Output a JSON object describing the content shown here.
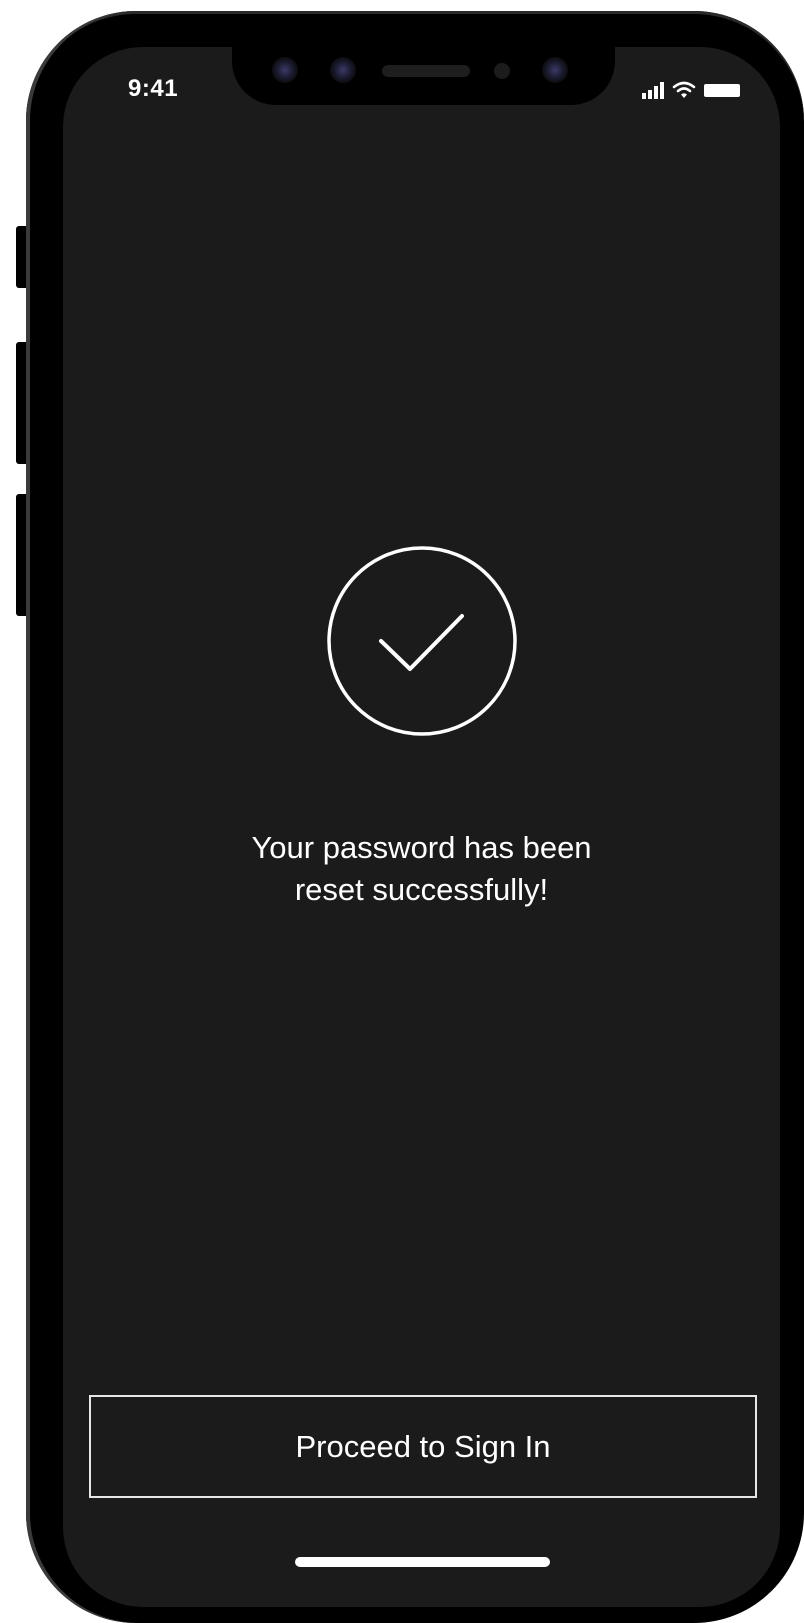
{
  "status_bar": {
    "time": "9:41",
    "icons": [
      "signal-icon",
      "wifi-icon",
      "battery-icon"
    ]
  },
  "success": {
    "icon": "checkmark-circle-icon",
    "message_line1": "Your password has been",
    "message_line2": "reset successfully!"
  },
  "actions": {
    "proceed_label": "Proceed to Sign In"
  },
  "colors": {
    "screen_background": "#1b1b1b",
    "foreground": "#ffffff",
    "device_frame": "#000000"
  }
}
